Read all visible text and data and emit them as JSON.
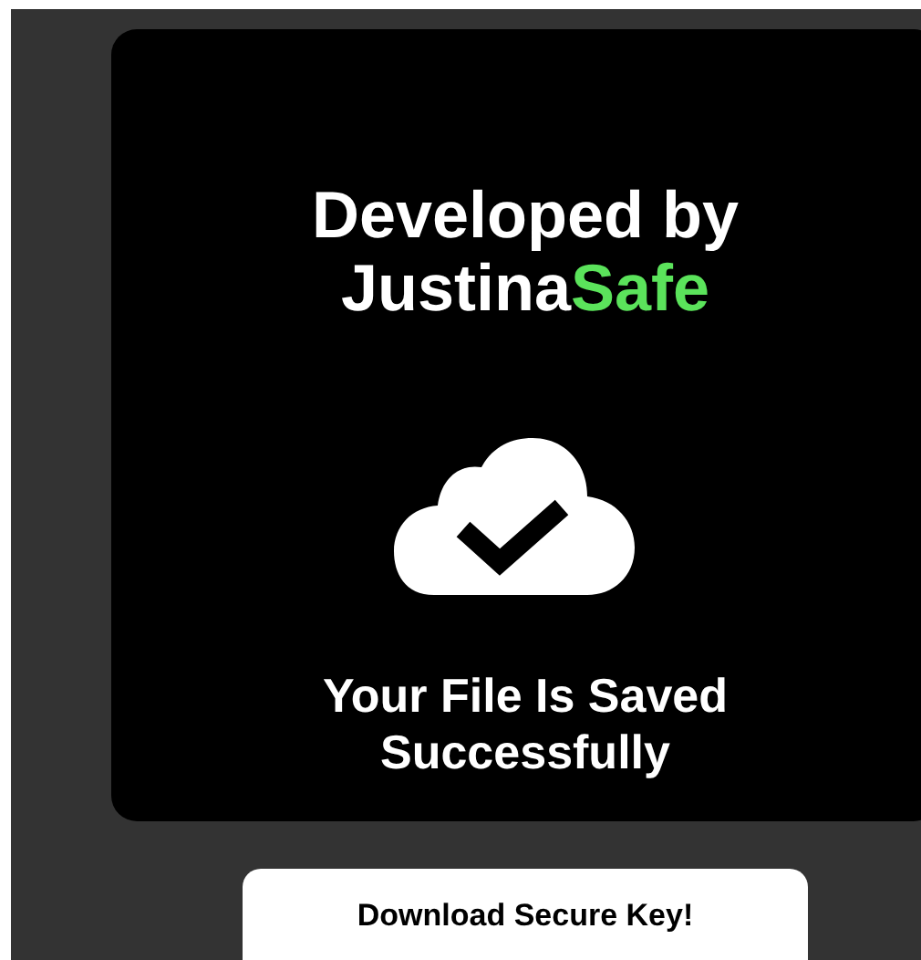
{
  "card": {
    "heading": "Developed by",
    "brand": "Justina",
    "brand_accent": "Safe",
    "message": "Your File Is Saved Successfully"
  },
  "button": {
    "label": "Download Secure Key!"
  }
}
